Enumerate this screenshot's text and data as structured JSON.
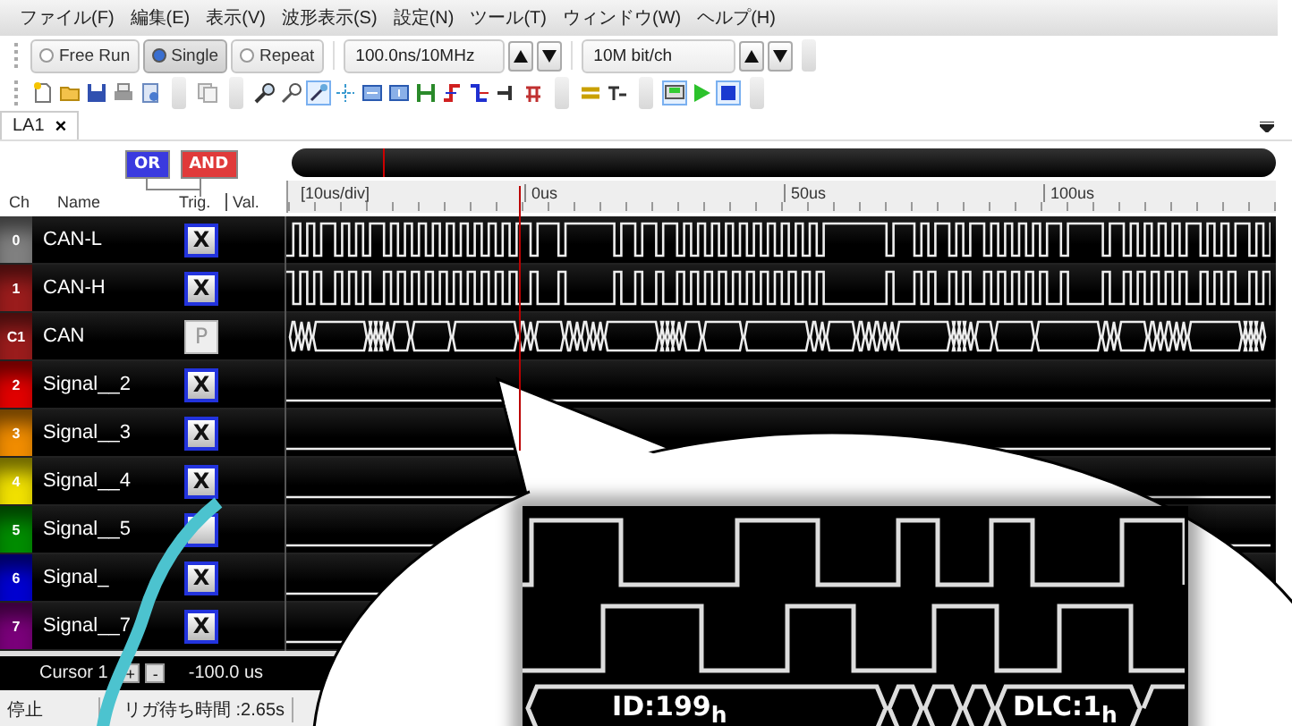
{
  "menu": [
    "ファイル(F)",
    "編集(E)",
    "表示(V)",
    "波形表示(S)",
    "設定(N)",
    "ツール(T)",
    "ウィンドウ(W)",
    "ヘルプ(H)"
  ],
  "toolbar": {
    "modes": [
      {
        "label": "Free Run",
        "selected": false
      },
      {
        "label": "Single",
        "selected": true
      },
      {
        "label": "Repeat",
        "selected": false
      }
    ],
    "timebase": "100.0ns/10MHz",
    "bitrate": "10M bit/ch"
  },
  "tabs": [
    {
      "label": "LA1",
      "close": "×",
      "selected": true
    }
  ],
  "trigger_logic": [
    {
      "label": "OR",
      "color": "#3a3adf"
    },
    {
      "label": "AND",
      "color": "#e03a3a"
    }
  ],
  "columns": [
    "Ch",
    "Name",
    "Trig.",
    "Val."
  ],
  "ruler": {
    "scale": "[10us/div]",
    "ticks": [
      "0us",
      "50us",
      "100us"
    ]
  },
  "channels": [
    {
      "ch": "0",
      "name": "CAN-L",
      "trigger": "X",
      "kind": "digital",
      "color": "#808080"
    },
    {
      "ch": "1",
      "name": "CAN-H",
      "trigger": "X",
      "kind": "digital",
      "color": "#9a1c1c"
    },
    {
      "ch": "C1",
      "name": "CAN",
      "trigger": "P",
      "kind": "bus",
      "color": "#9a1c1c"
    },
    {
      "ch": "2",
      "name": "Signal__2",
      "trigger": "X",
      "kind": "flat",
      "color": "#e00000"
    },
    {
      "ch": "3",
      "name": "Signal__3",
      "trigger": "X",
      "kind": "flat",
      "color": "#f08c00"
    },
    {
      "ch": "4",
      "name": "Signal__4",
      "trigger": "X",
      "kind": "flat",
      "color": "#f0e000"
    },
    {
      "ch": "5",
      "name": "Signal__5",
      "kind": "flat",
      "color": "#008c00"
    },
    {
      "ch": "6",
      "name": "Signal_",
      "trigger": "X",
      "kind": "flat",
      "color": "#0000d0"
    },
    {
      "ch": "7",
      "name": "Signal__7",
      "trigger": "X",
      "kind": "flat",
      "color": "#7a007a"
    }
  ],
  "cursor": {
    "label": "Cursor 1",
    "plus": "+",
    "minus": "-",
    "value": "-100.0 us"
  },
  "status": [
    "停止",
    "リガ待ち時間 :2.65s"
  ],
  "callout": {
    "labels": [
      "ID:199$_{h}$",
      "DLC:1$_{h}$"
    ]
  }
}
